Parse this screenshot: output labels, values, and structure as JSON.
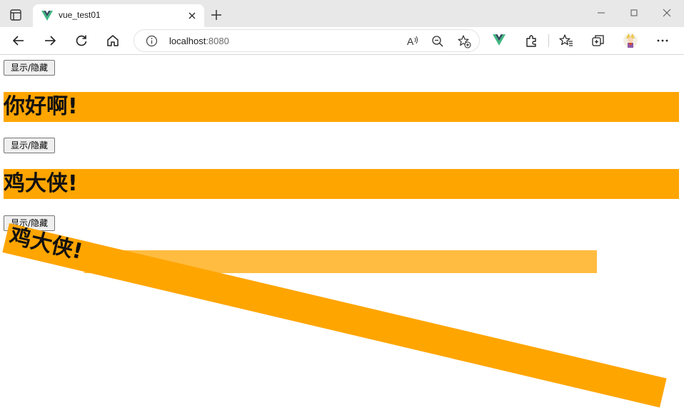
{
  "browser": {
    "tab": {
      "title": "vue_test01"
    },
    "address_bar": {
      "host": "localhost",
      "port": ":8080"
    }
  },
  "page": {
    "sections": [
      {
        "button_label": "显示/隐藏",
        "heading": "你好啊!"
      },
      {
        "button_label": "显示/隐藏",
        "heading": "鸡大侠!"
      },
      {
        "button_label": "显示/隐藏",
        "heading": "鸡大侠!"
      }
    ],
    "heading_color": "#ffa500"
  },
  "icons": [
    "sidebar-icon",
    "vue-favicon-icon",
    "close-icon",
    "plus-icon",
    "minimize-icon",
    "maximize-icon",
    "window-close-icon",
    "back-arrow-icon",
    "forward-arrow-icon",
    "refresh-icon",
    "home-icon",
    "info-icon",
    "read-aloud-icon",
    "zoom-out-icon",
    "add-favorite-icon",
    "vue-devtools-icon",
    "extensions-icon",
    "favorites-icon",
    "collections-icon",
    "profile-avatar",
    "more-icon"
  ]
}
